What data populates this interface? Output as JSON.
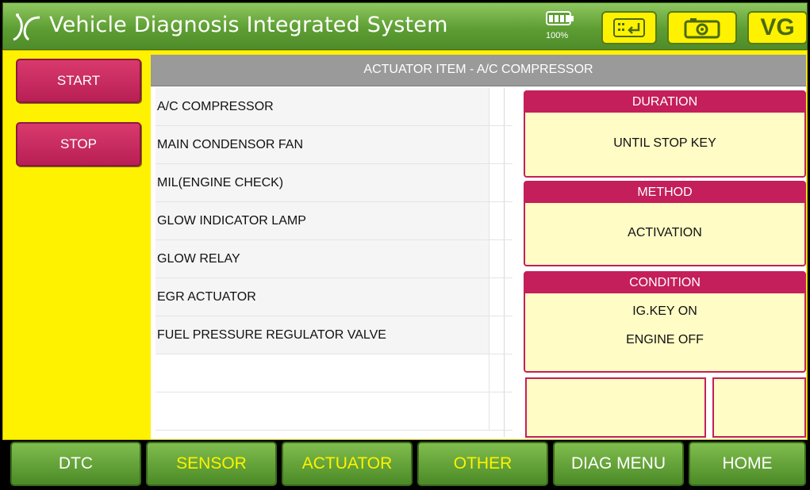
{
  "title_bar": {
    "app_title": "Vehicle Diagnosis Integrated System",
    "battery_level": "100%",
    "vg_label": "VG",
    "logo_icon": "jc-logo-icon",
    "battery_icon": "battery-icon",
    "keyboard_icon": "keyboard-enter-icon",
    "camera_icon": "camera-icon"
  },
  "side_buttons": {
    "start_label": "START",
    "stop_label": "STOP"
  },
  "panel": {
    "header": "ACTUATOR ITEM - A/C COMPRESSOR",
    "items": [
      "A/C COMPRESSOR",
      "MAIN CONDENSOR FAN",
      "MIL(ENGINE CHECK)",
      "GLOW INDICATOR LAMP",
      "GLOW RELAY",
      "EGR ACTUATOR",
      "FUEL PRESSURE REGULATOR VALVE"
    ]
  },
  "info": {
    "duration_title": "DURATION",
    "duration_value": "UNTIL STOP KEY",
    "method_title": "METHOD",
    "method_value": "ACTIVATION",
    "condition_title": "CONDITION",
    "condition_line1": "IG.KEY ON",
    "condition_line2": "ENGINE OFF"
  },
  "bottom_nav": {
    "dtc": "DTC",
    "sensor": "SENSOR",
    "actuator": "ACTUATOR",
    "other": "OTHER",
    "diag_menu": "DIAG MENU",
    "home": "HOME"
  },
  "colors": {
    "title_green": "#5d9e33",
    "yellow": "#fff200",
    "magenta": "#c41f5a",
    "header_gray": "#9a9a9a"
  }
}
